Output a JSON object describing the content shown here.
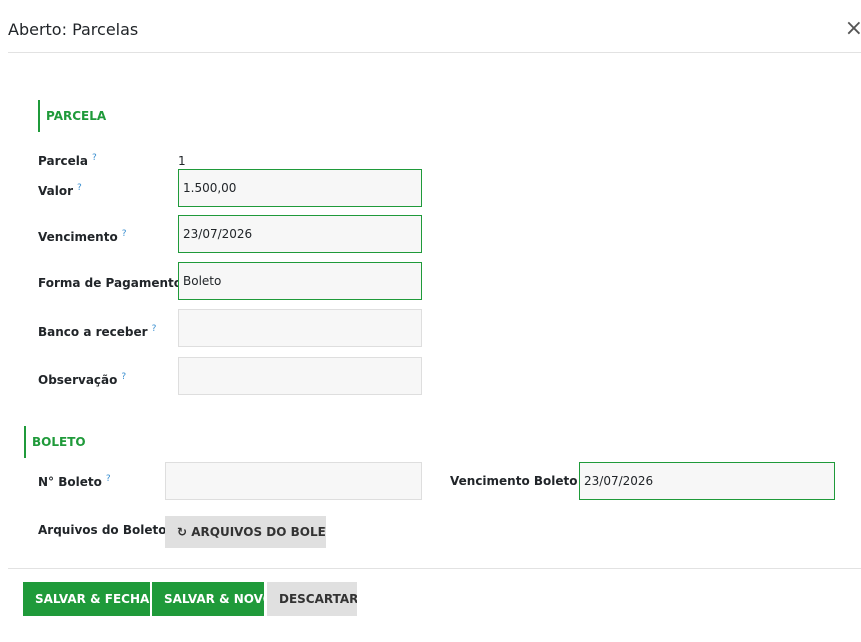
{
  "dialog": {
    "title": "Aberto: Parcelas",
    "close_icon": "×"
  },
  "sections": {
    "parcela": "PARCELA",
    "boleto": "BOLETO"
  },
  "help_mark": "?",
  "fields": {
    "parcela": {
      "label": "Parcela",
      "value": "1"
    },
    "valor": {
      "label": "Valor",
      "value": "1.500,00"
    },
    "vencimento": {
      "label": "Vencimento",
      "value": "23/07/2026"
    },
    "forma_pagamento": {
      "label": "Forma de Pagamento",
      "value": "Boleto"
    },
    "banco_receber": {
      "label": "Banco a receber",
      "value": ""
    },
    "observacao": {
      "label": "Observação",
      "value": ""
    },
    "numero_boleto": {
      "label": "N° Boleto",
      "value": ""
    },
    "vencimento_boleto": {
      "label": "Vencimento Boleto",
      "value": "23/07/2026"
    },
    "arquivos_boleto": {
      "label": "Arquivos do Boleto"
    }
  },
  "buttons": {
    "arquivos_boleto": "↻ ARQUIVOS DO BOLETO",
    "salvar_fechar": "SALVAR & FECHAR",
    "salvar_novo": "SALVAR & NOVO",
    "descartar": "DESCARTAR"
  },
  "colors": {
    "accent": "#1f9a3a",
    "help": "#3a8fd0",
    "field_bg": "#f7f7f7",
    "secondary_button": "#e0e0e0"
  }
}
